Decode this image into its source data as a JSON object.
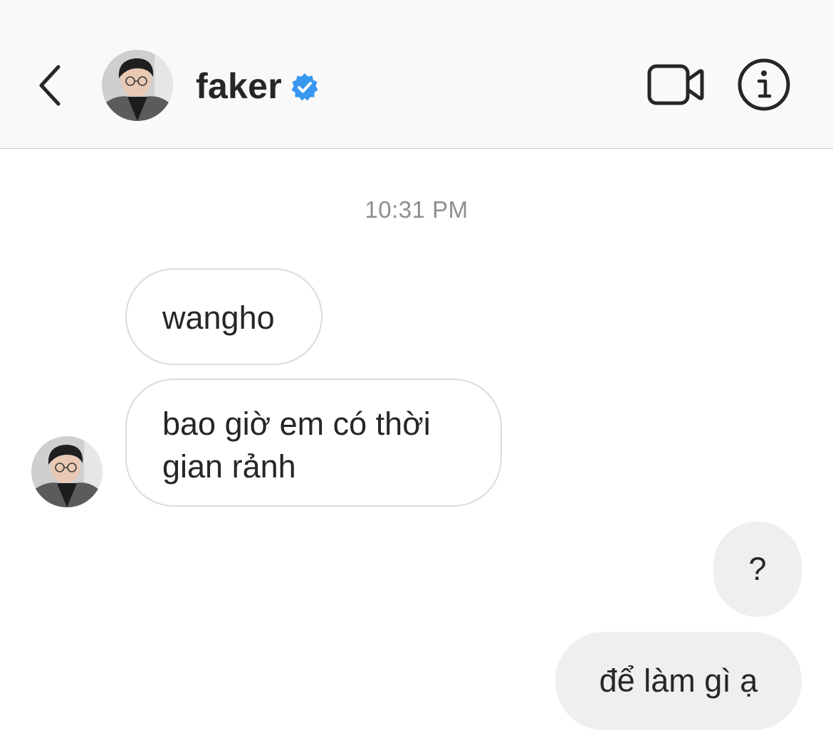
{
  "header": {
    "username": "faker",
    "verified": true,
    "icons": {
      "back": "chevron-left-icon",
      "verified": "verified-badge-icon",
      "video": "video-camera-icon",
      "info": "info-circle-icon"
    },
    "colors": {
      "verified_blue": "#3897f0",
      "header_bg": "#f9f9f9"
    }
  },
  "thread": {
    "timestamp": "10:31 PM",
    "messages": [
      {
        "direction": "incoming",
        "text": "wangho"
      },
      {
        "direction": "incoming",
        "text_line_1": "bao giờ em có thời",
        "text_line_2": "gian rảnh"
      },
      {
        "direction": "outgoing",
        "text": "?"
      },
      {
        "direction": "outgoing",
        "text": "để làm gì ạ"
      }
    ]
  }
}
